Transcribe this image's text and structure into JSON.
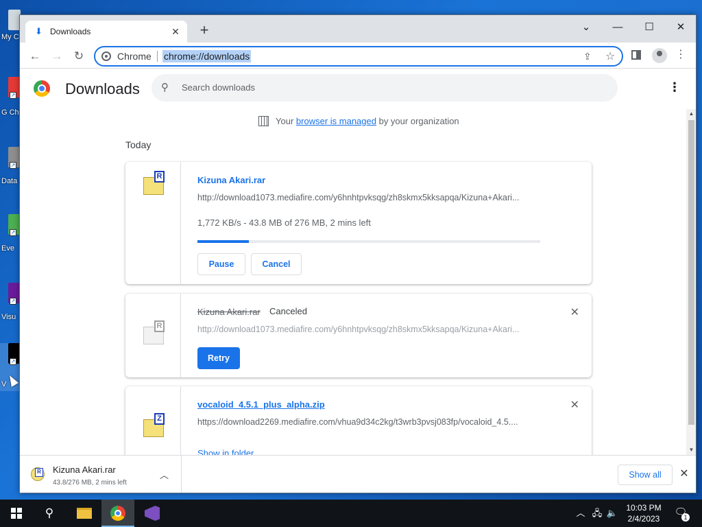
{
  "desktop": {
    "icons": [
      {
        "label": "My C",
        "color": "#cfd8dc"
      },
      {
        "label": "G Ch",
        "color": "#e53935"
      },
      {
        "label": "Data",
        "color": "#8e8e8e"
      },
      {
        "label": "Eve",
        "color": "#4caf50"
      },
      {
        "label": "Visu",
        "color": "#6a1b9a"
      },
      {
        "label": "V",
        "color": "#000000"
      }
    ]
  },
  "browser": {
    "tab": {
      "title": "Downloads",
      "icon": "download-icon"
    },
    "omnibox": {
      "site": "Chrome",
      "url": "chrome://downloads"
    },
    "accent": "#1a73e8"
  },
  "page": {
    "title": "Downloads",
    "search_placeholder": "Search downloads",
    "managed": {
      "prefix": "Your",
      "link": "browser is managed",
      "suffix": "by your organization"
    },
    "section_label": "Today",
    "downloads": [
      {
        "name": "Kizuna Akari.rar",
        "url": "http://download1073.mediafire.com/y6hnhtpvksqg/zh8skmx5kksapqa/Kizuna+Akari...",
        "progress_text": "1,772 KB/s - 43.8 MB of 276 MB, 2 mins left",
        "progress": 0.15,
        "pause_label": "Pause",
        "cancel_label": "Cancel",
        "badge": "R"
      },
      {
        "name": "Kizuna Akari.rar",
        "status": "Canceled",
        "url": "http://download1073.mediafire.com/y6hnhtpvksqg/zh8skmx5kksapqa/Kizuna+Akari...",
        "retry_label": "Retry",
        "badge": "R"
      },
      {
        "name": "vocaloid_4.5.1_plus_alpha.zip",
        "url": "https://download2269.mediafire.com/vhua9d34c2kg/t3wrb3pvsj083fp/vocaloid_4.5....",
        "action_label": "Show in folder",
        "badge": "Z"
      }
    ]
  },
  "shelf": {
    "name": "Kizuna Akari.rar",
    "status": "43.8/276 MB, 2 mins left",
    "show_all_label": "Show all"
  },
  "taskbar": {
    "time": "10:03 PM",
    "date": "2/4/2023",
    "notification_count": "1"
  }
}
